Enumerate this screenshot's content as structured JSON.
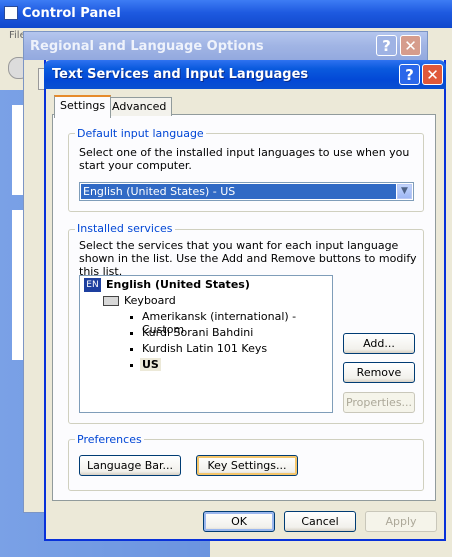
{
  "control_panel": {
    "title": "Control Panel",
    "menu_file": "File"
  },
  "regional": {
    "title": "Regional and Language Options"
  },
  "dialog": {
    "title": "Text Services and Input Languages",
    "help_glyph": "?",
    "close_glyph": "✕",
    "tabs": [
      {
        "label": "Settings",
        "selected": true
      },
      {
        "label": "Advanced",
        "selected": false
      }
    ],
    "default_input": {
      "group_label": "Default input language",
      "description": "Select one of the installed input languages to use when you start your computer.",
      "selected_value": "English (United States) - US",
      "dropdown_glyph": "▼"
    },
    "installed_services": {
      "group_label": "Installed services",
      "description": "Select the services that you want for each input language shown in the list. Use the Add and Remove buttons to modify this list.",
      "language_badge": "EN",
      "language": "English (United States)",
      "category": "Keyboard",
      "services": [
        "Amerikansk (international) - Custom",
        "Kurdi Sorani Bahdini",
        "Kurdish Latin 101 Keys",
        "US"
      ],
      "add_label": "Add...",
      "remove_label": "Remove",
      "properties_label": "Properties..."
    },
    "preferences": {
      "group_label": "Preferences",
      "language_bar_label": "Language Bar...",
      "key_settings_label": "Key Settings..."
    },
    "footer": {
      "ok_label": "OK",
      "cancel_label": "Cancel",
      "apply_label": "Apply"
    }
  },
  "colors": {
    "title_active": "#0a5ade",
    "title_inactive": "#a0b4e4",
    "selection": "#316ac5",
    "group_label": "#0046d5",
    "xp_taskpane": "#6b94df"
  }
}
